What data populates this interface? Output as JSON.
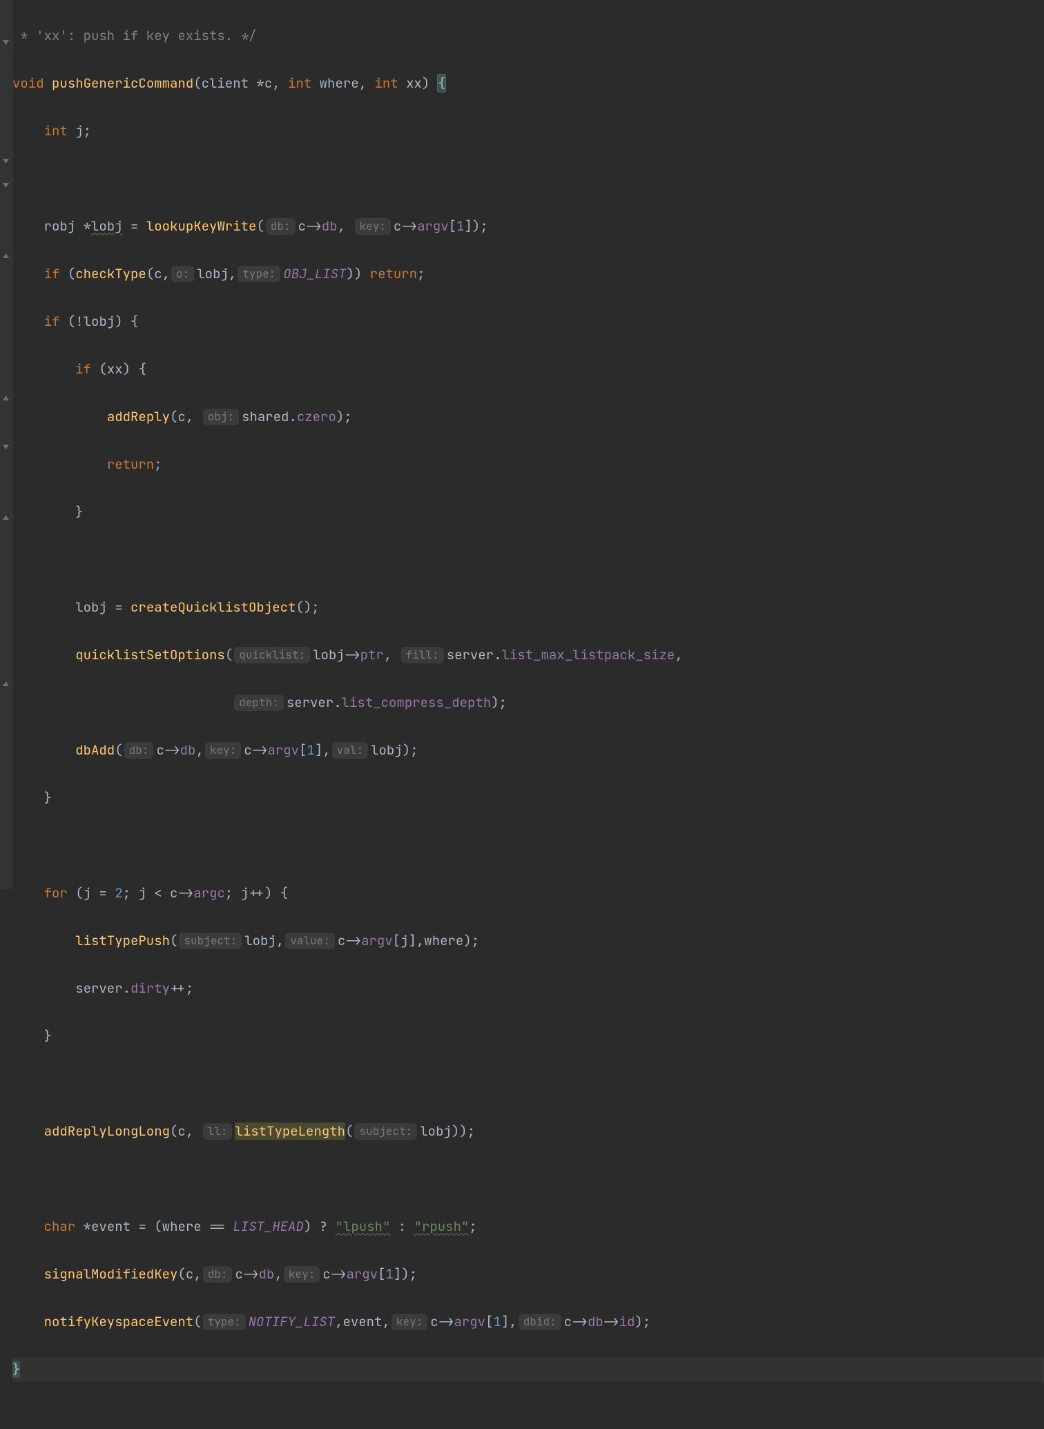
{
  "lines": {
    "l0_comment": " * 'xx': push if key exists. */",
    "kw_void": "void",
    "fn_name": "pushGenericCommand",
    "kw_int": "int",
    "kw_if": "if",
    "kw_for": "for",
    "kw_return": "return",
    "kw_char": "char",
    "sig_p1_t": "client *",
    "sig_p1": "c",
    "sig_p2": "where",
    "sig_p3": "xx",
    "var_j": "j",
    "t_robj": "robj *",
    "var_lobj": "lobj",
    "fn_lookup": "lookupKeyWrite",
    "h_db": "db:",
    "h_key": "key:",
    "h_val": "val:",
    "h_o": "o:",
    "h_type": "type:",
    "h_obj": "obj:",
    "h_ql": "quicklist:",
    "h_fill": "fill:",
    "h_depth": "depth:",
    "h_subject": "subject:",
    "h_value": "value:",
    "h_ll": "ll:",
    "h_dbid": "dbid:",
    "txt_cdb": "c->",
    "mbr_db": "db",
    "mbr_argv": "argv",
    "mbr_argc": "argc",
    "mbr_ptr": "ptr",
    "mbr_dirty": "dirty",
    "mbr_czero": "czero",
    "mbr_id": "id",
    "mbr_lm": "list_max_listpack_size",
    "mbr_lcd": "list_compress_depth",
    "var_server": "server",
    "var_shared": "shared",
    "fn_checkType": "checkType",
    "const_OBJ": "OBJ_LIST",
    "const_LH": "LIST_HEAD",
    "const_NL": "NOTIFY_LIST",
    "fn_addReply": "addReply",
    "fn_cqo": "createQuicklistObject",
    "fn_qso": "quicklistSetOptions",
    "fn_dbAdd": "dbAdd",
    "fn_ltp": "listTypePush",
    "fn_arll": "addReplyLongLong",
    "fn_ltl": "listTypeLength",
    "fn_smk": "signalModifiedKey",
    "fn_nke": "notifyKeyspaceEvent",
    "var_event": "event",
    "num_1": "1",
    "num_2": "2",
    "str_lpush": "\"lpush\"",
    "str_rpush": "\"rpush\""
  }
}
